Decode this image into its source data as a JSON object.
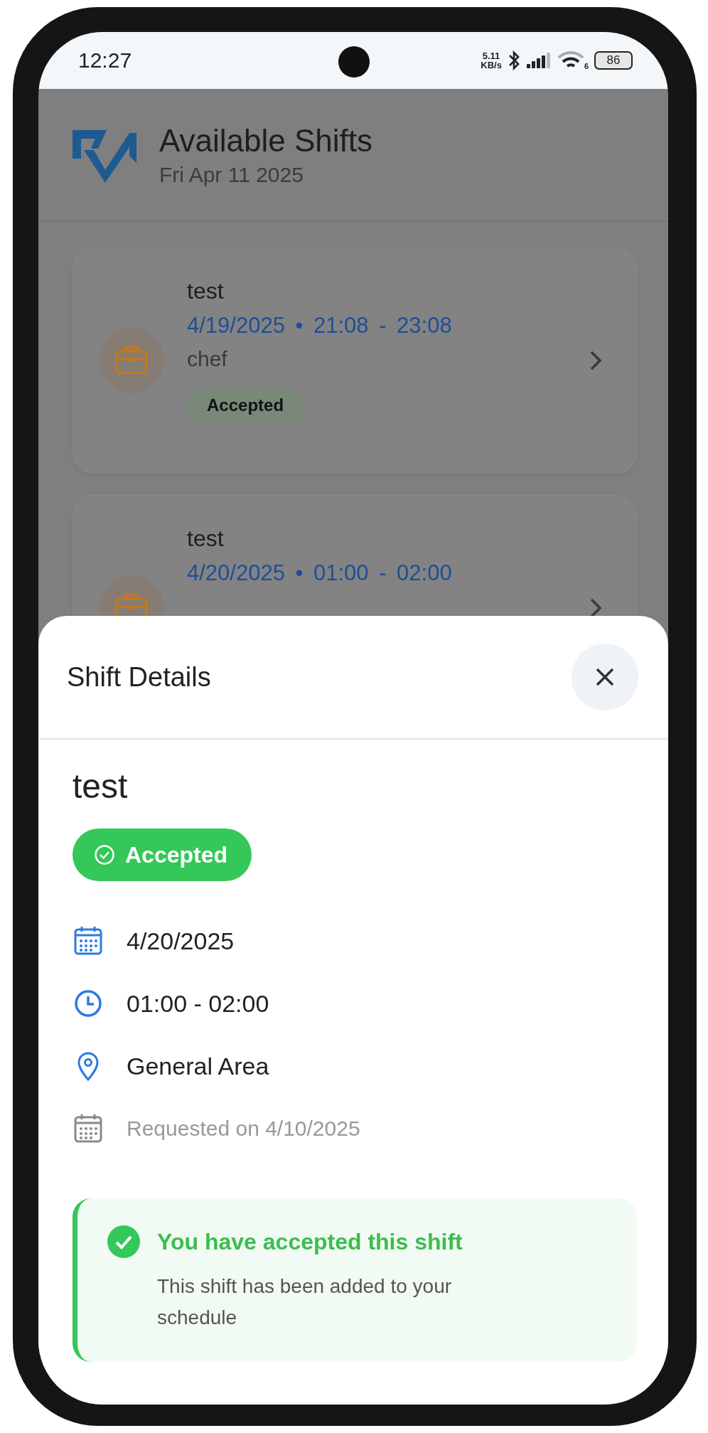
{
  "status_bar": {
    "time": "12:27",
    "net_speed": "5.11",
    "net_unit": "KB/s",
    "wifi_badge": "6",
    "battery": "86"
  },
  "header": {
    "title": "Available Shifts",
    "date": "Fri Apr 11 2025"
  },
  "shifts": [
    {
      "title": "test",
      "schedule": "4/19/2025 • 21:08 - 23:08",
      "role": "chef",
      "status": "Accepted"
    },
    {
      "title": "test",
      "schedule": "4/20/2025 • 01:00 - 02:00"
    }
  ],
  "details": {
    "title": "Shift Details",
    "name": "test",
    "status": "Accepted",
    "rows": [
      {
        "kind": "date",
        "text": "4/20/2025",
        "muted": false
      },
      {
        "kind": "time",
        "text": "01:00 - 02:00",
        "muted": false
      },
      {
        "kind": "location",
        "text": "General Area",
        "muted": false
      },
      {
        "kind": "date",
        "text": "Requested on 4/10/2025",
        "muted": true
      }
    ],
    "banner": {
      "title": "You have accepted this shift",
      "text": "This shift has been added to your schedule"
    }
  }
}
